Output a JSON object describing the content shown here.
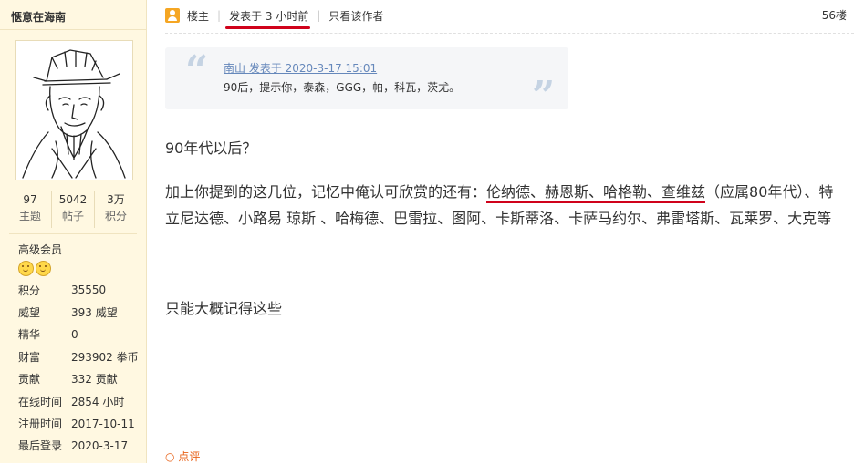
{
  "sidebar": {
    "username": "惬意在海南",
    "stats": [
      {
        "num": "97",
        "label": "主题"
      },
      {
        "num": "5042",
        "label": "帖子"
      },
      {
        "num": "3万",
        "label": "积分"
      }
    ],
    "rank": "高级会员",
    "info": [
      {
        "k": "积分",
        "v": "35550"
      },
      {
        "k": "威望",
        "v": "393 威望"
      },
      {
        "k": "精华",
        "v": "0"
      },
      {
        "k": "财富",
        "v": "293902 拳币"
      },
      {
        "k": "贡献",
        "v": "332 贡献"
      },
      {
        "k": "在线时间",
        "v": "2854 小时"
      },
      {
        "k": "注册时间",
        "v": "2017-10-11"
      },
      {
        "k": "最后登录",
        "v": "2020-3-17"
      }
    ]
  },
  "post": {
    "op_label": "楼主",
    "time_label": "发表于 3 小时前",
    "author_only": "只看该作者",
    "floor": "56楼",
    "quote": {
      "author_line": "南山 发表于 2020-3-17 15:01",
      "body": "90后，提示你，泰森，GGG，帕，科瓦，茨尤。"
    },
    "para1": "90年代以后？",
    "para2_prefix": "加上你提到的这几位，记忆中俺认可欣赏的还有：",
    "para2_highlight": "伦纳德、赫恩斯、哈格勒、查维兹",
    "para2_suffix": "（应属80年代）、特立尼达德、小路易 琼斯 、哈梅德、巴雷拉、图阿、卡斯蒂洛、卡萨马约尔、弗雷塔斯、瓦莱罗、大克等",
    "para3": "只能大概记得这些",
    "rate_label": "点评"
  },
  "colors": {
    "sidebar_bg": "#fff8e1",
    "annotation_red": "#d0021b",
    "link_blue": "#6688bb"
  }
}
